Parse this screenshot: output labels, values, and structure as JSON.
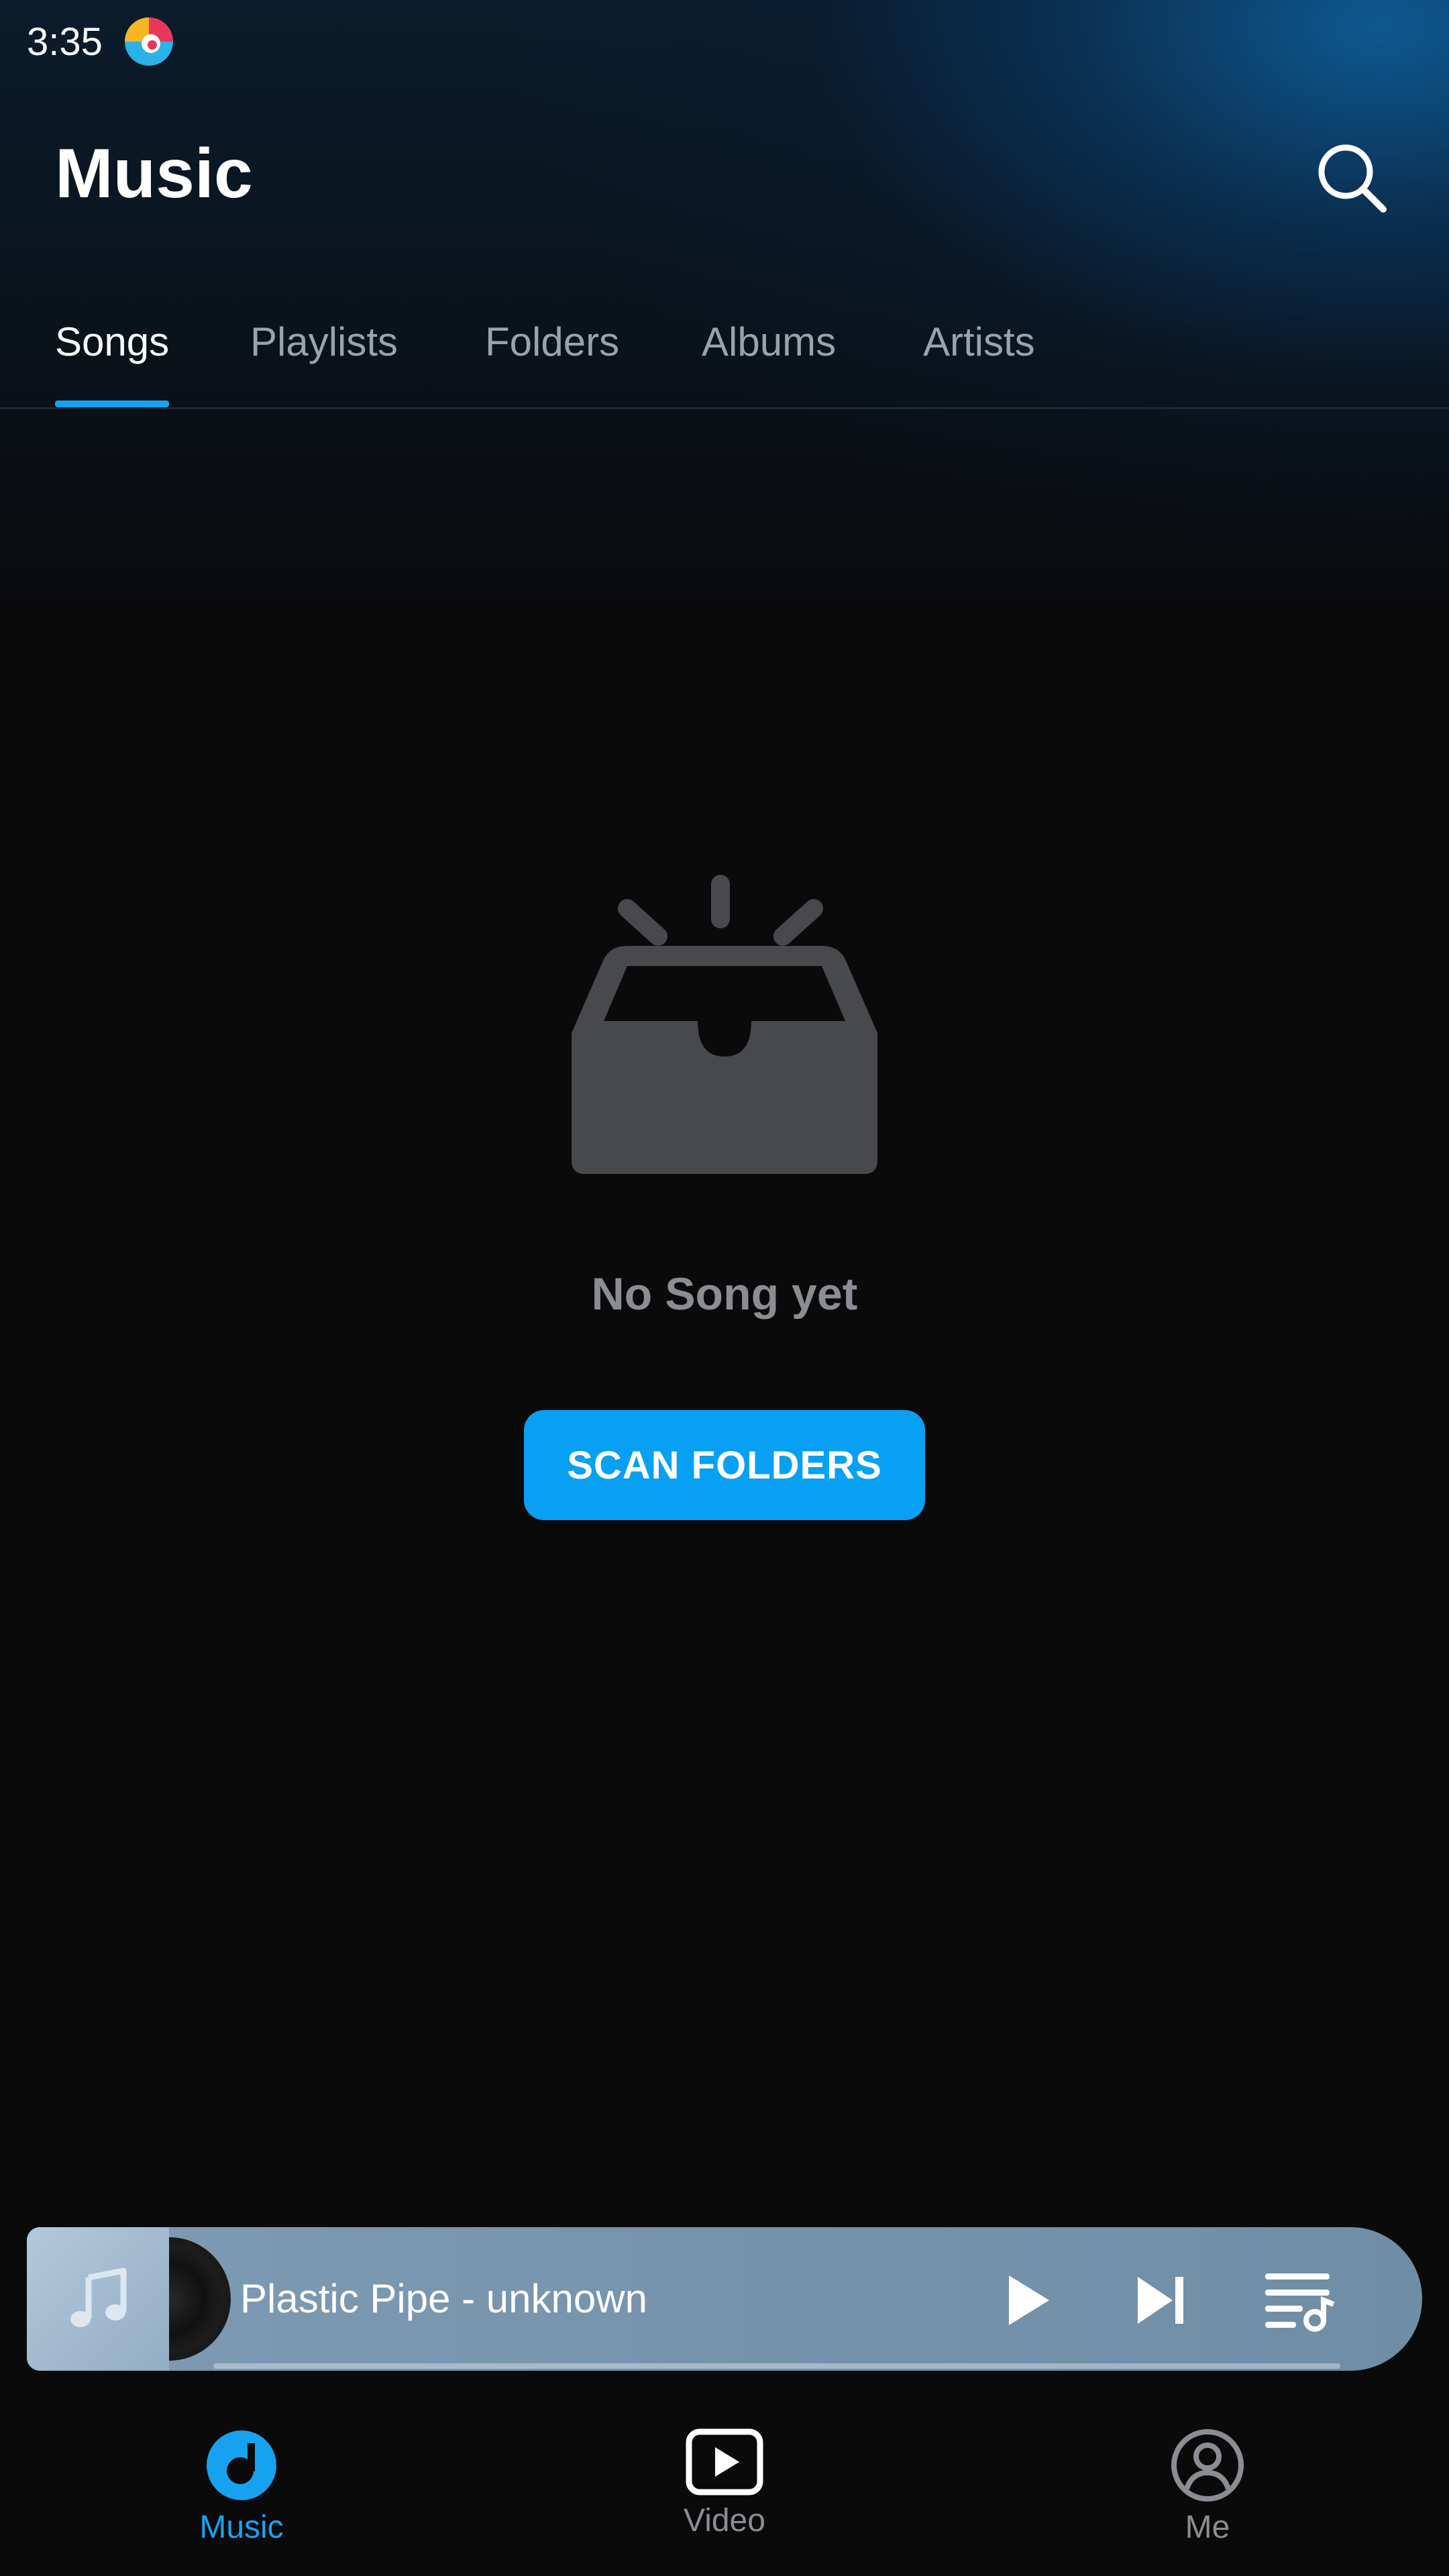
{
  "status_bar": {
    "time": "3:35"
  },
  "header": {
    "title": "Music"
  },
  "tabs": [
    {
      "label": "Songs",
      "active": true
    },
    {
      "label": "Playlists",
      "active": false
    },
    {
      "label": "Folders",
      "active": false
    },
    {
      "label": "Albums",
      "active": false
    },
    {
      "label": "Artists",
      "active": false
    }
  ],
  "empty_state": {
    "message": "No Song yet",
    "button_label": "SCAN FOLDERS"
  },
  "mini_player": {
    "track_title": "Plastic Pipe - unknown",
    "progress": 0.0
  },
  "bottom_nav": [
    {
      "label": "Music",
      "icon": "music-disc-icon",
      "active": true
    },
    {
      "label": "Video",
      "icon": "video-play-icon",
      "active": false
    },
    {
      "label": "Me",
      "icon": "profile-icon",
      "active": false
    }
  ],
  "colors": {
    "accent": "#17a2f0",
    "button": "#07a0f2",
    "background": "#0a0a0b",
    "muted_text": "#8a8d91",
    "player_bg": "#7895ae"
  }
}
